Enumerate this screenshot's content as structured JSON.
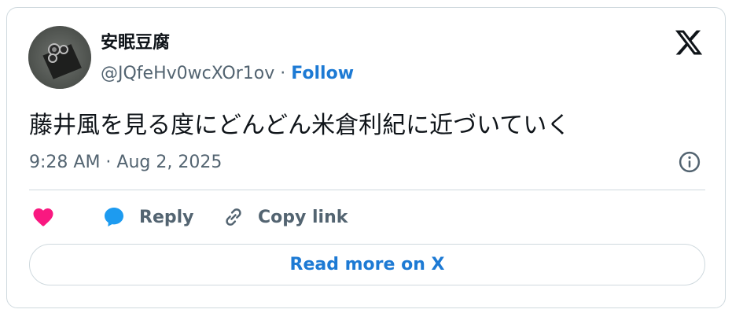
{
  "tweet": {
    "author_name": "安眠豆腐",
    "handle": "@JQfeHv0wcXOr1ov",
    "separator": "·",
    "follow_label": "Follow",
    "text": "藤井風を見る度にどんどん米倉利紀に近づいていく",
    "timestamp": "9:28 AM · Aug 2, 2025"
  },
  "actions": {
    "like_icon": "heart-icon",
    "reply_label": "Reply",
    "copy_link_label": "Copy link"
  },
  "read_more_label": "Read more on X",
  "colors": {
    "heart": "#f91880",
    "reply_icon": "#1d9bf0",
    "link": "#1d7ad4",
    "muted": "#536471",
    "text": "#0f1419",
    "border": "#cfd9de"
  }
}
